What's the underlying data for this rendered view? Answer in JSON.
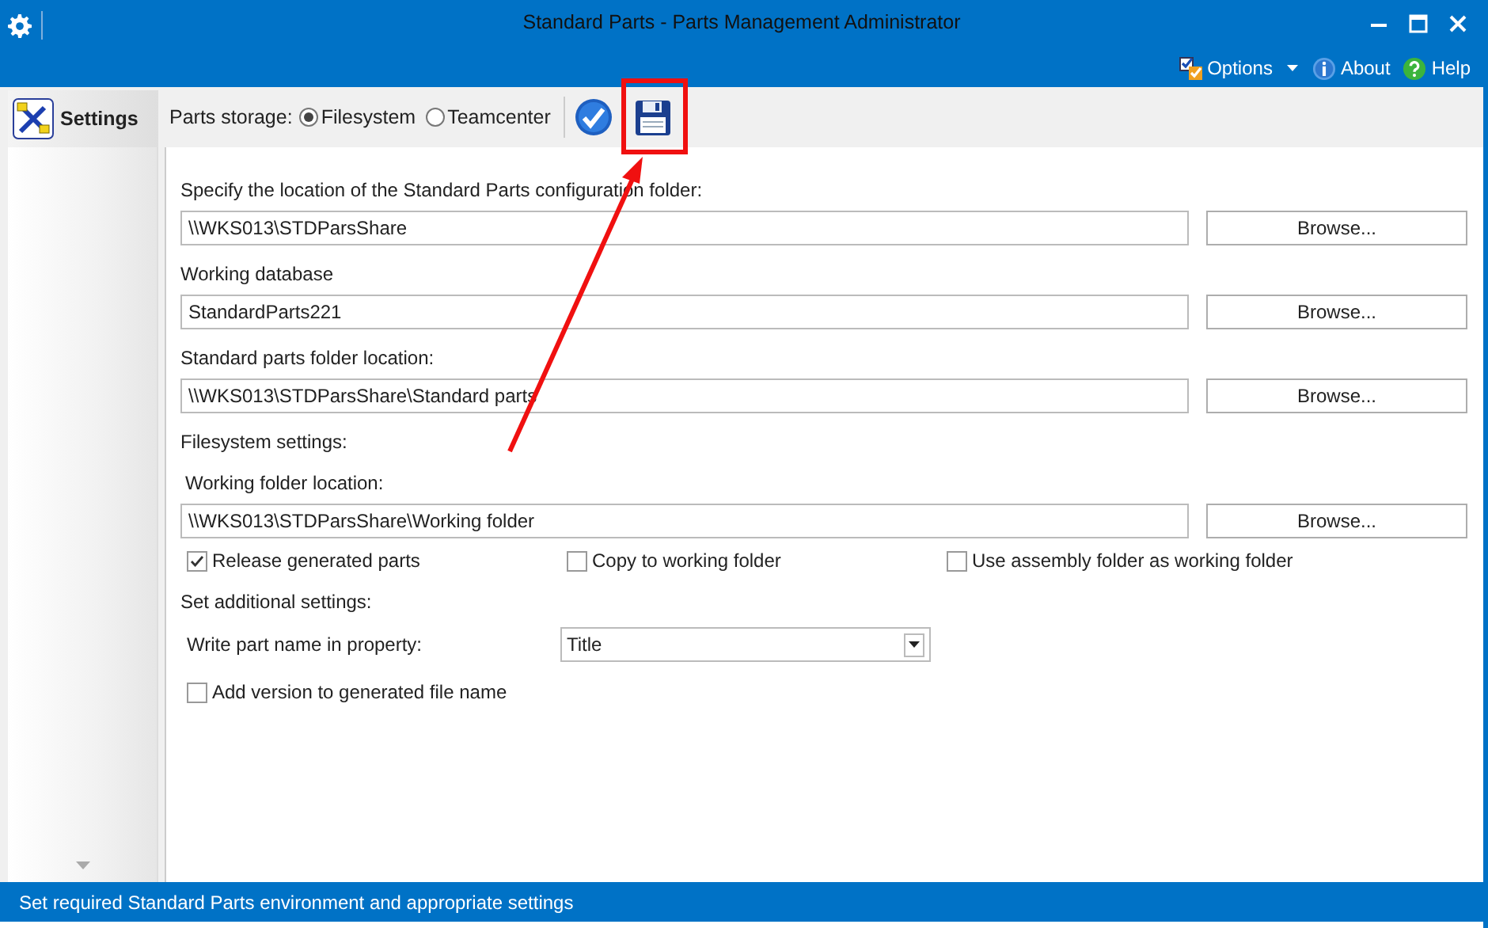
{
  "window": {
    "title": "Standard Parts - Parts Management Administrator"
  },
  "menu": [
    {
      "label": "Options",
      "kind": "options"
    },
    {
      "label": "About",
      "kind": "about"
    },
    {
      "label": "Help",
      "kind": "help"
    }
  ],
  "sidebar": {
    "items": [
      {
        "label": "Settings",
        "selected": true
      }
    ]
  },
  "toolbar": {
    "storage_label": "Parts storage:",
    "storage_options": [
      {
        "label": "Filesystem",
        "selected": true
      },
      {
        "label": "Teamcenter",
        "selected": false
      }
    ]
  },
  "form": {
    "rows": [
      {
        "kind": "label",
        "text": "Specify the location of the Standard Parts configuration folder:"
      },
      {
        "kind": "path",
        "value": "\\\\WKS013\\STDParsShare",
        "button": "Browse..."
      },
      {
        "kind": "label",
        "text": "Working database"
      },
      {
        "kind": "path",
        "value": "StandardParts221",
        "button": "Browse..."
      },
      {
        "kind": "label",
        "text": "Standard parts folder location:"
      },
      {
        "kind": "path",
        "value": "\\\\WKS013\\STDParsShare\\Standard parts",
        "button": "Browse..."
      },
      {
        "kind": "label",
        "text": "Filesystem settings:"
      },
      {
        "kind": "label",
        "text": "Working folder location:"
      },
      {
        "kind": "path",
        "value": "\\\\WKS013\\STDParsShare\\Working folder",
        "button": "Browse..."
      },
      {
        "kind": "checks",
        "items": [
          {
            "label": "Release generated parts",
            "checked": true
          },
          {
            "label": "Copy to working folder",
            "checked": false
          },
          {
            "label": "Use assembly folder as working folder",
            "checked": false
          }
        ]
      },
      {
        "kind": "label",
        "text": "Set additional settings:"
      },
      {
        "kind": "select",
        "label": "Write part name in property:",
        "value": "Title"
      },
      {
        "kind": "checks",
        "items": [
          {
            "label": "Add version to generated file name",
            "checked": false
          }
        ]
      }
    ]
  },
  "status_bar": "Set required Standard Parts environment and appropriate settings"
}
